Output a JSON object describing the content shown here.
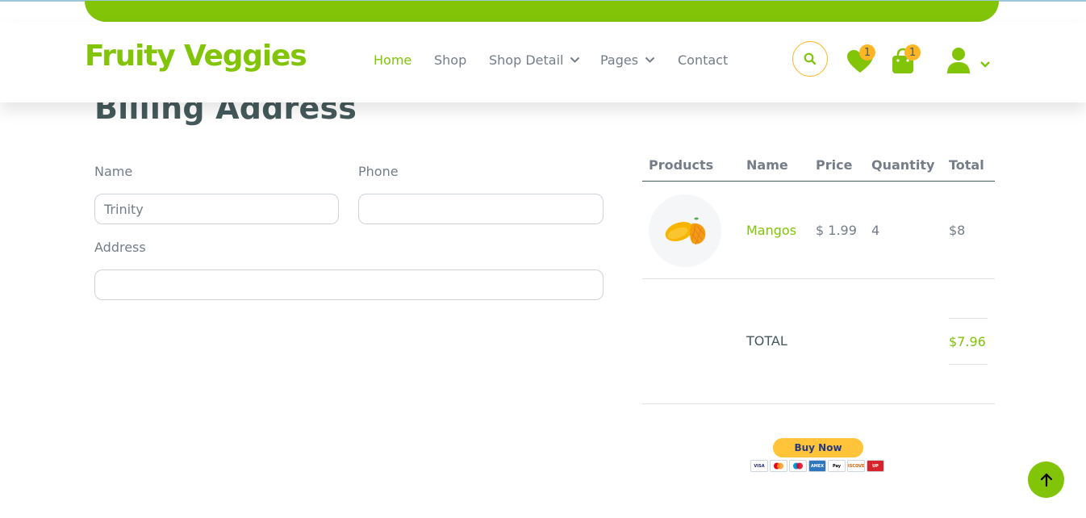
{
  "brand": {
    "name": "Fruity Veggies",
    "color": "#81c408"
  },
  "accent_colors": {
    "primary": "#81c408",
    "secondary": "#ffb524",
    "dark": "#45595b"
  },
  "nav": {
    "items": [
      {
        "label": "Home",
        "active": true,
        "dropdown": false
      },
      {
        "label": "Shop",
        "active": false,
        "dropdown": false
      },
      {
        "label": "Shop Detail",
        "active": false,
        "dropdown": true
      },
      {
        "label": "Pages",
        "active": false,
        "dropdown": true
      },
      {
        "label": "Contact",
        "active": false,
        "dropdown": false
      }
    ]
  },
  "header_icons": {
    "search_icon": "search-icon",
    "wishlist": {
      "icon": "heart-icon",
      "count": "1"
    },
    "cart": {
      "icon": "shopping-bag-icon",
      "count": "1"
    },
    "account": {
      "icon": "user-icon",
      "dropdown_icon": "chevron-down-icon"
    }
  },
  "billing": {
    "title": "Billing Address",
    "name_label": "Name",
    "name_value": "Trinity",
    "phone_label": "Phone",
    "phone_value": "",
    "address_label": "Address",
    "address_value": ""
  },
  "order_table": {
    "headers": [
      "Products",
      "Name",
      "Price",
      "Quantity",
      "Total"
    ],
    "rows": [
      {
        "image": "mango-image",
        "name": "Mangos",
        "price": "$ 1.99",
        "quantity": "4",
        "total": "$8"
      }
    ],
    "total_label": "TOTAL",
    "total_value": "$7.96"
  },
  "paypal": {
    "button_label": "Buy Now",
    "cards": [
      "VISA",
      "MC",
      "Maestro",
      "AMEX",
      "Pay",
      "DISCOVER",
      "UP"
    ]
  },
  "back_to_top_icon": "arrow-up-icon"
}
